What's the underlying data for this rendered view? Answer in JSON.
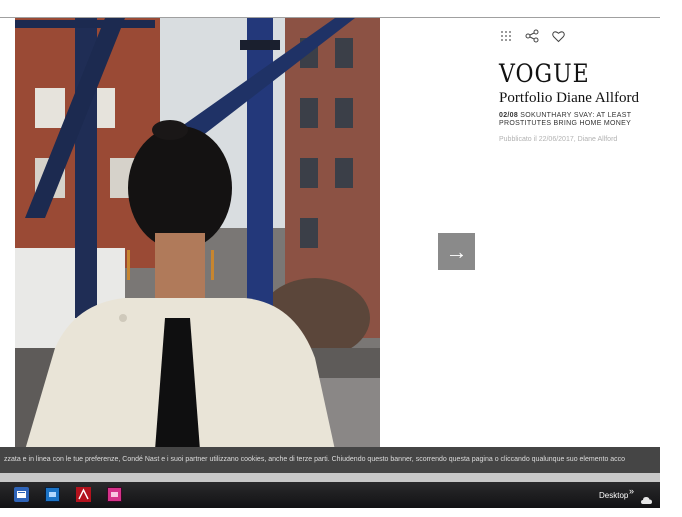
{
  "article": {
    "logo": "VOGUE",
    "title": "Portfolio Diane Allford",
    "slide_counter": "02/08",
    "slide_caption": "SOKUNTHARY SVAY: AT LEAST PROSTITUTES BRING HOME MONEY",
    "published": "Pubblicato il 22/06/2017, Diane Allford"
  },
  "toolbar": {
    "grid_icon": "grid-icon",
    "share_icon": "share-icon",
    "heart_icon": "heart-icon"
  },
  "gallery": {
    "next_arrow": "→"
  },
  "cookie_banner": {
    "text": "zzata e in linea con le tue preferenze, Condé Nast e i suoi partner utilizzano cookies, anche di terze parti. Chiudendo questo banner, scorrendo questa pagina o cliccando qualunque suo elemento acco"
  },
  "taskbar": {
    "desktop_label": "Desktop",
    "overflow_chevron": "»",
    "apps": [
      "outlook-icon",
      "photoshop-icon",
      "acrobat-icon",
      "indesign-icon"
    ]
  },
  "colors": {
    "cookie_bg": "#454545",
    "next_button_bg": "#8a8a8a",
    "taskbar_bg": "#1c1c1e"
  }
}
